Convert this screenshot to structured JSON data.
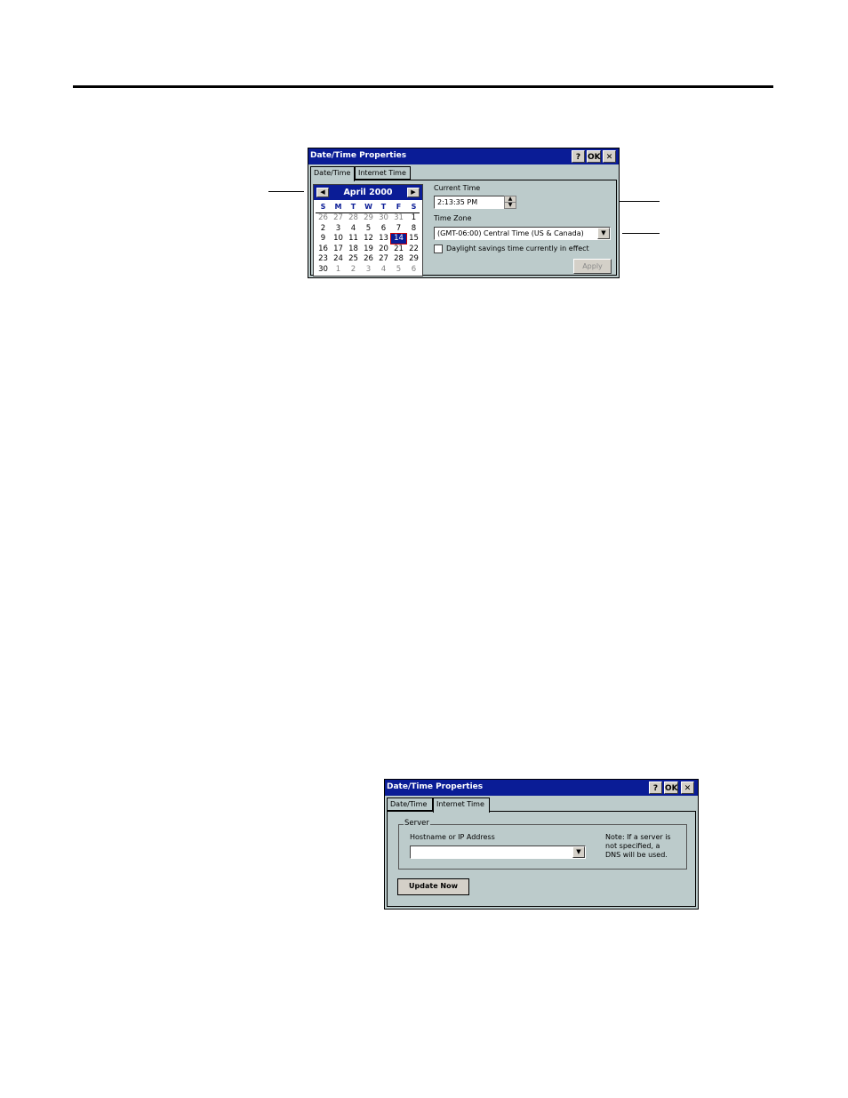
{
  "dialog1": {
    "title": "Date/Time Properties",
    "title_buttons": {
      "help": "?",
      "ok": "OK",
      "close": "✕"
    },
    "tabs": [
      {
        "label": "Date/Time",
        "active": true
      },
      {
        "label": "Internet Time",
        "active": false
      }
    ],
    "calendar": {
      "month_label": "April 2000",
      "prev": "◀",
      "next": "▶",
      "dows": [
        "S",
        "M",
        "T",
        "W",
        "T",
        "F",
        "S"
      ],
      "weeks": [
        [
          "26",
          "27",
          "28",
          "29",
          "30",
          "31",
          "1"
        ],
        [
          "2",
          "3",
          "4",
          "5",
          "6",
          "7",
          "8"
        ],
        [
          "9",
          "10",
          "11",
          "12",
          "13",
          "14",
          "15"
        ],
        [
          "16",
          "17",
          "18",
          "19",
          "20",
          "21",
          "22"
        ],
        [
          "23",
          "24",
          "25",
          "26",
          "27",
          "28",
          "29"
        ],
        [
          "30",
          "1",
          "2",
          "3",
          "4",
          "5",
          "6"
        ]
      ],
      "selected_day": "14"
    },
    "current_time_label": "Current Time",
    "current_time_value": "2:13:35 PM",
    "time_zone_label": "Time Zone",
    "time_zone_value": "(GMT-06:00) Central Time (US & Canada)",
    "dst_label": "Daylight savings time currently in effect",
    "dst_checked": false,
    "apply_label": "Apply"
  },
  "dialog2": {
    "title": "Date/Time Properties",
    "title_buttons": {
      "help": "?",
      "ok": "OK",
      "close": "✕"
    },
    "tabs": [
      {
        "label": "Date/Time",
        "active": false
      },
      {
        "label": "Internet Time",
        "active": true
      }
    ],
    "group_label": "Server",
    "hostname_label": "Hostname or IP Address",
    "hostname_value": "",
    "note_lines": [
      "Note: If a server is",
      "not specified, a",
      "DNS will be used."
    ],
    "update_button": "Update Now"
  },
  "icons": {
    "dropdown": "▼",
    "spin_up": "▲",
    "spin_down": "▼"
  }
}
